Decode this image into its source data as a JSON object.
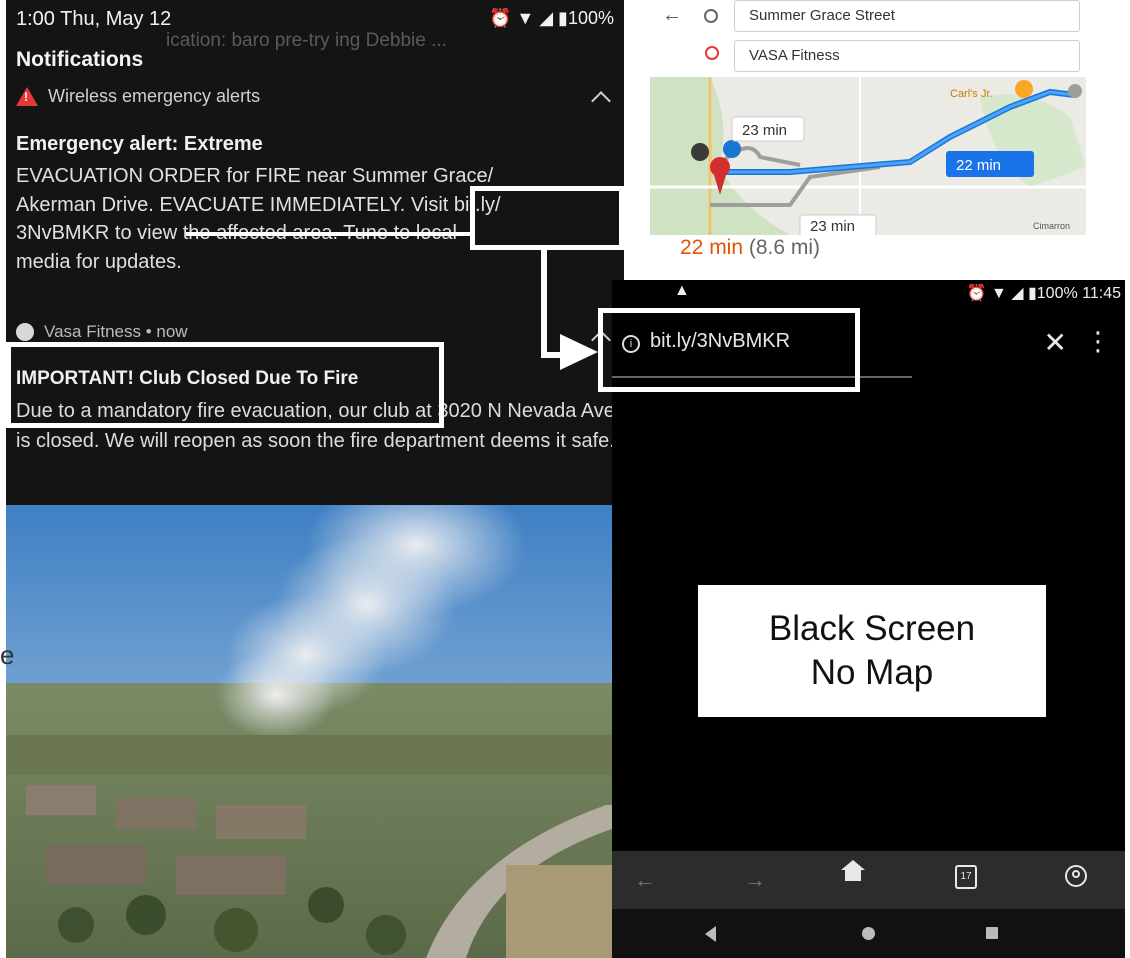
{
  "notifications": {
    "status_time": "1:00 Thu, May 12",
    "status_right": "⏰ ▼ ◢ ▮100%",
    "title": "Notifications",
    "ghost_text": "ication: baro pre-try ing Debbie ...",
    "alert_category": "Wireless emergency alerts",
    "alert_title": "Emergency alert: Extreme",
    "alert_line1": "EVACUATION ORDER for FIRE near Summer Grace/",
    "alert_line2a": "Akerman Drive. ",
    "alert_line2_link": "EVACUATE IMMEDIATELY",
    "alert_line2b": ". Visit bit.ly/",
    "alert_line3": "3NvBMKR to view the affected area. Tune to local",
    "alert_line4": "media for updates.",
    "vasa_source": "Vasa Fitness • now",
    "vasa_title": "IMPORTANT! Club Closed Due To Fire",
    "vasa_body": "Due to a mandatory fire evacuation, our club at 3020 N Nevada Ave is closed. We will reopen as soon the fire department deems it safe."
  },
  "maps": {
    "origin": "Summer Grace Street",
    "destination": "VASA Fitness",
    "route_alt1": "23 min",
    "route_main": "22 min",
    "route_alt2": "23 min",
    "place_label": "Carl's Jr.",
    "area_label": "Cimarron",
    "summary_time": "22 min",
    "summary_distance": "(8.6 mi)"
  },
  "browser": {
    "status_right": "⏰ ▼ ◢ ▮100% 11:45",
    "url": "bit.ly/3NvBMKR",
    "close_glyph": "✕",
    "menu_glyph": "⋮",
    "tab_count": "17",
    "back_glyph": "←",
    "forward_glyph": "→"
  },
  "callout": {
    "line1": "Black Screen",
    "line2": "No Map"
  },
  "side_letter": "e"
}
